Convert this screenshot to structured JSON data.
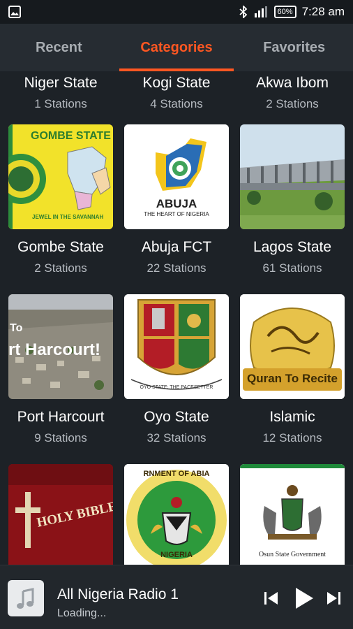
{
  "status_bar": {
    "battery": "60%",
    "time": "7:28 am"
  },
  "tabs": [
    {
      "label": "Recent"
    },
    {
      "label": "Categories"
    },
    {
      "label": "Favorites"
    }
  ],
  "categories": [
    {
      "name": "Niger State",
      "count": "1 Stations"
    },
    {
      "name": "Kogi State",
      "count": "4 Stations"
    },
    {
      "name": "Akwa Ibom",
      "count": "2 Stations"
    },
    {
      "name": "Gombe State",
      "count": "2 Stations",
      "image_text": [
        "GOMBE STATE",
        "JEWEL IN THE SAVANNAH"
      ]
    },
    {
      "name": "Abuja FCT",
      "count": "22 Stations",
      "image_text": [
        "ABUJA",
        "THE HEART OF NIGERIA"
      ]
    },
    {
      "name": "Lagos State",
      "count": "61 Stations"
    },
    {
      "name": "Port Harcourt",
      "count": "9 Stations",
      "image_text": [
        "To",
        "rt Harcourt!"
      ]
    },
    {
      "name": "Oyo State",
      "count": "32 Stations",
      "image_text": [
        "OYO STATE: THE PACESETTER"
      ]
    },
    {
      "name": "Islamic",
      "count": "12 Stations",
      "image_text": [
        "Quran To Recite"
      ]
    },
    {
      "name": "",
      "count": "",
      "image_text": [
        "HOLY BIBLE"
      ]
    },
    {
      "name": "",
      "count": "",
      "image_text": [
        "RNMENT OF ABIA",
        "NIGERIA"
      ]
    },
    {
      "name": "",
      "count": "",
      "image_text": [
        "Osun State Government"
      ]
    }
  ],
  "player": {
    "title": "All Nigeria Radio 1",
    "status": "Loading..."
  },
  "colors": {
    "accent": "#ff5722",
    "background": "#1d2227",
    "tab_bar": "#262c32"
  },
  "icons": [
    "image-notification-icon",
    "bluetooth-icon",
    "signal-icon",
    "battery-icon",
    "music-note-icon",
    "skip-previous-icon",
    "play-icon",
    "skip-next-icon"
  ]
}
